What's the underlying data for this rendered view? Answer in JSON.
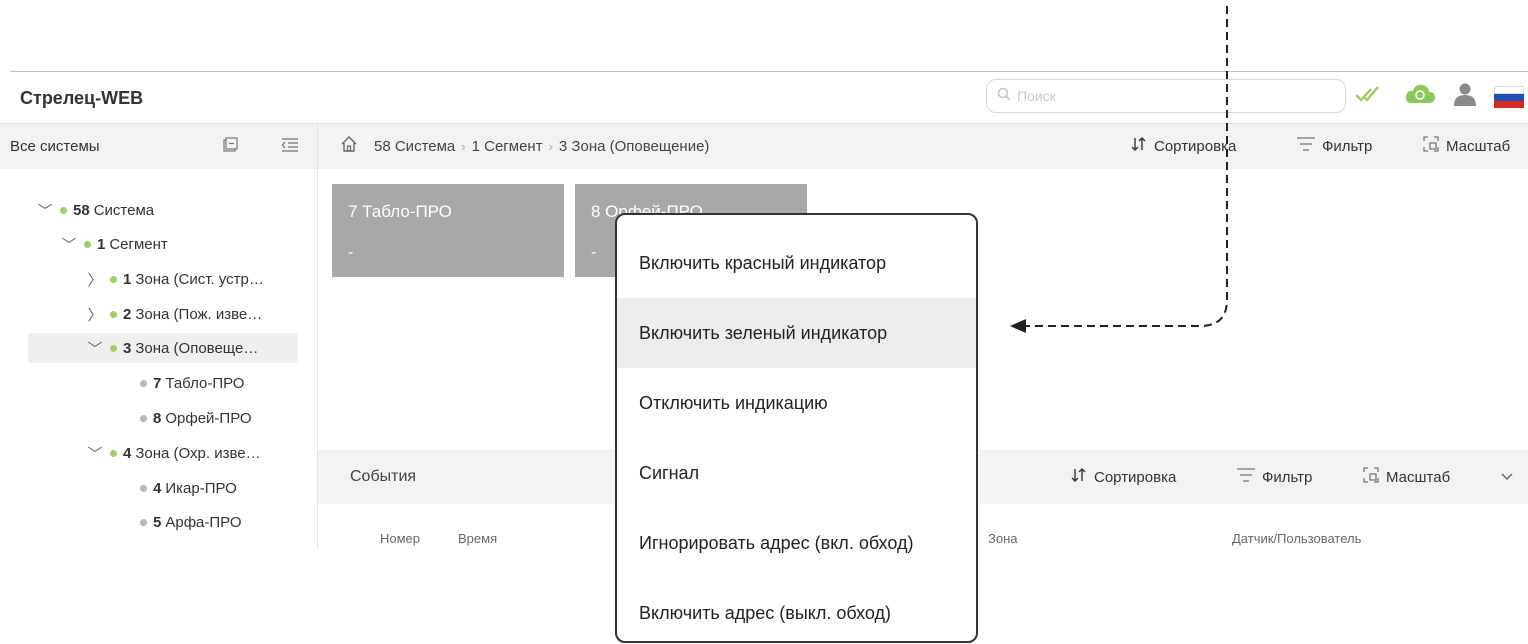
{
  "app": {
    "title": "Стрелец-WEB"
  },
  "search": {
    "placeholder": "Поиск"
  },
  "flag": {
    "colors": [
      "#ffffff",
      "#1f4fb5",
      "#d52b1e"
    ]
  },
  "sidebar": {
    "heading": "Все системы",
    "tree": [
      {
        "num": "58",
        "label": "Система",
        "status": "green",
        "expanded": true
      },
      {
        "num": "1",
        "label": "Сегмент",
        "status": "green",
        "expanded": true
      },
      {
        "num": "1",
        "label": "Зона (Сист. устр…",
        "status": "green",
        "expanded": false
      },
      {
        "num": "2",
        "label": "Зона (Пож. изве…",
        "status": "green",
        "expanded": false
      },
      {
        "num": "3",
        "label": "Зона (Оповеще…",
        "status": "green",
        "expanded": true,
        "selected": true
      },
      {
        "num": "7",
        "label": "Табло-ПРО",
        "status": "gray"
      },
      {
        "num": "8",
        "label": "Орфей-ПРО",
        "status": "gray"
      },
      {
        "num": "4",
        "label": "Зона (Охр. изве…",
        "status": "green",
        "expanded": true
      },
      {
        "num": "4",
        "label": "Икар-ПРО",
        "status": "gray"
      },
      {
        "num": "5",
        "label": "Арфа-ПРО",
        "status": "gray"
      }
    ]
  },
  "breadcrumb": {
    "items": [
      "58 Система",
      "1 Сегмент",
      "3 Зона (Оповещение)"
    ]
  },
  "toolbar": {
    "sort": "Сортировка",
    "filter": "Фильтр",
    "scale": "Масштаб"
  },
  "cards": [
    {
      "title": "7 Табло-ПРО",
      "sub": "-"
    },
    {
      "title": "8 Орфей-ПРО",
      "sub": "-"
    }
  ],
  "events": {
    "title": "События",
    "sort": "Сортировка",
    "filter": "Фильтр",
    "scale": "Масштаб",
    "columns": [
      "Номер",
      "Время",
      "Зона",
      "Датчик/Пользователь"
    ]
  },
  "context_menu": {
    "items": [
      "Включить красный индикатор",
      "Включить зеленый индикатор",
      "Отключить индикацию",
      "Сигнал",
      "Игнорировать адрес (вкл. обход)",
      "Включить адрес (выкл. обход)"
    ],
    "highlighted_index": 1
  }
}
